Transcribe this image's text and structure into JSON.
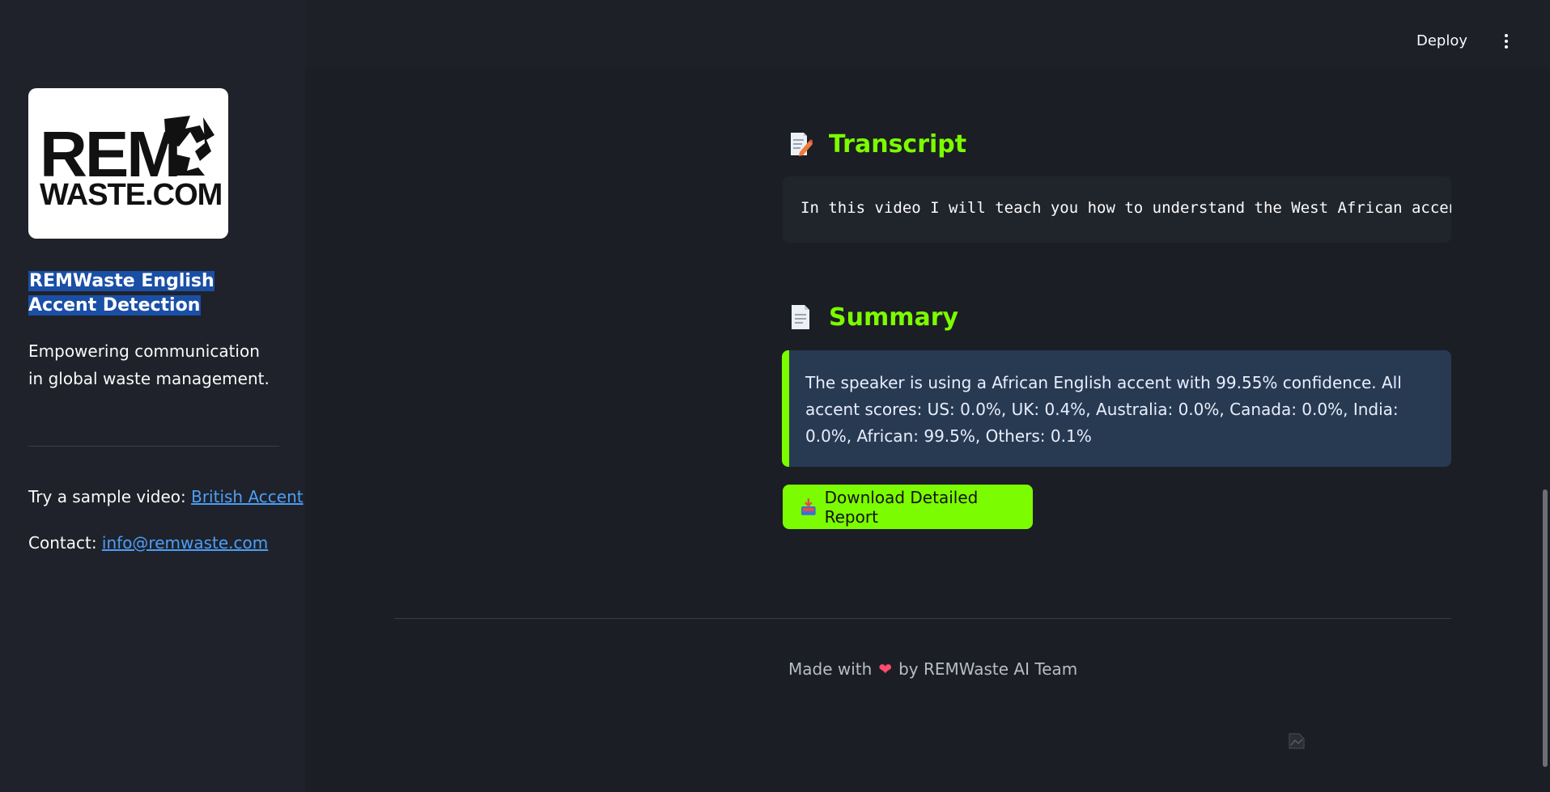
{
  "sidebar": {
    "logo": {
      "line1": "REM",
      "line2": "WASTE.COM"
    },
    "app_title": "REMWaste English Accent Detection",
    "tagline": "Empowering communication in global waste management.",
    "sample_prefix": "Try a sample video:",
    "sample_link": "British Accent",
    "contact_prefix": "Contact:",
    "contact_link": "info@remwaste.com"
  },
  "header": {
    "deploy_label": "Deploy",
    "menu_icon": "kebab-menu-icon"
  },
  "transcript": {
    "icon": "memo-pencil-icon",
    "title": "Transcript",
    "text": "In this video I will teach you how to understand the West African accent"
  },
  "summary": {
    "icon": "document-icon",
    "title": "Summary",
    "text": "The speaker is using a African English accent with 99.55% confidence. All accent scores: US: 0.0%, UK: 0.4%, Australia: 0.0%, Canada: 0.0%, India: 0.0%, African: 99.5%, Others: 0.1%"
  },
  "download": {
    "icon": "inbox-download-icon",
    "label": "Download Detailed Report"
  },
  "footer": {
    "made_with": "Made with",
    "heart": "❤",
    "by": "by REMWaste AI Team"
  },
  "colors": {
    "accent": "#7cfc00",
    "link": "#4d9ef7",
    "info_bg": "#283a52",
    "selection": "#1a4fa6"
  }
}
